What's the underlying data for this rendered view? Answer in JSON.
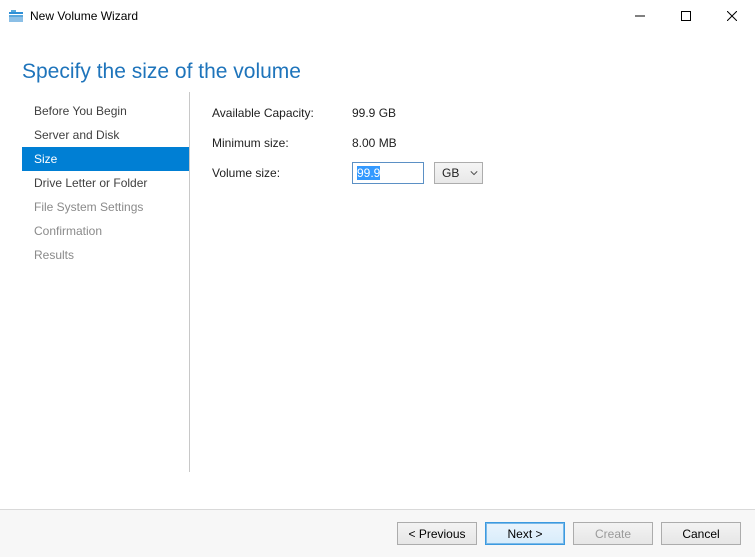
{
  "window": {
    "title": "New Volume Wizard"
  },
  "heading": "Specify the size of the volume",
  "steps": [
    {
      "label": "Before You Begin",
      "state": "normal"
    },
    {
      "label": "Server and Disk",
      "state": "normal"
    },
    {
      "label": "Size",
      "state": "active"
    },
    {
      "label": "Drive Letter or Folder",
      "state": "normal"
    },
    {
      "label": "File System Settings",
      "state": "disabled"
    },
    {
      "label": "Confirmation",
      "state": "disabled"
    },
    {
      "label": "Results",
      "state": "disabled"
    }
  ],
  "fields": {
    "available_capacity": {
      "label": "Available Capacity:",
      "value": "99.9 GB"
    },
    "minimum_size": {
      "label": "Minimum size:",
      "value": "8.00 MB"
    },
    "volume_size": {
      "label": "Volume size:",
      "value": "99.9",
      "unit": "GB"
    }
  },
  "buttons": {
    "previous": "< Previous",
    "next": "Next >",
    "create": "Create",
    "cancel": "Cancel"
  }
}
